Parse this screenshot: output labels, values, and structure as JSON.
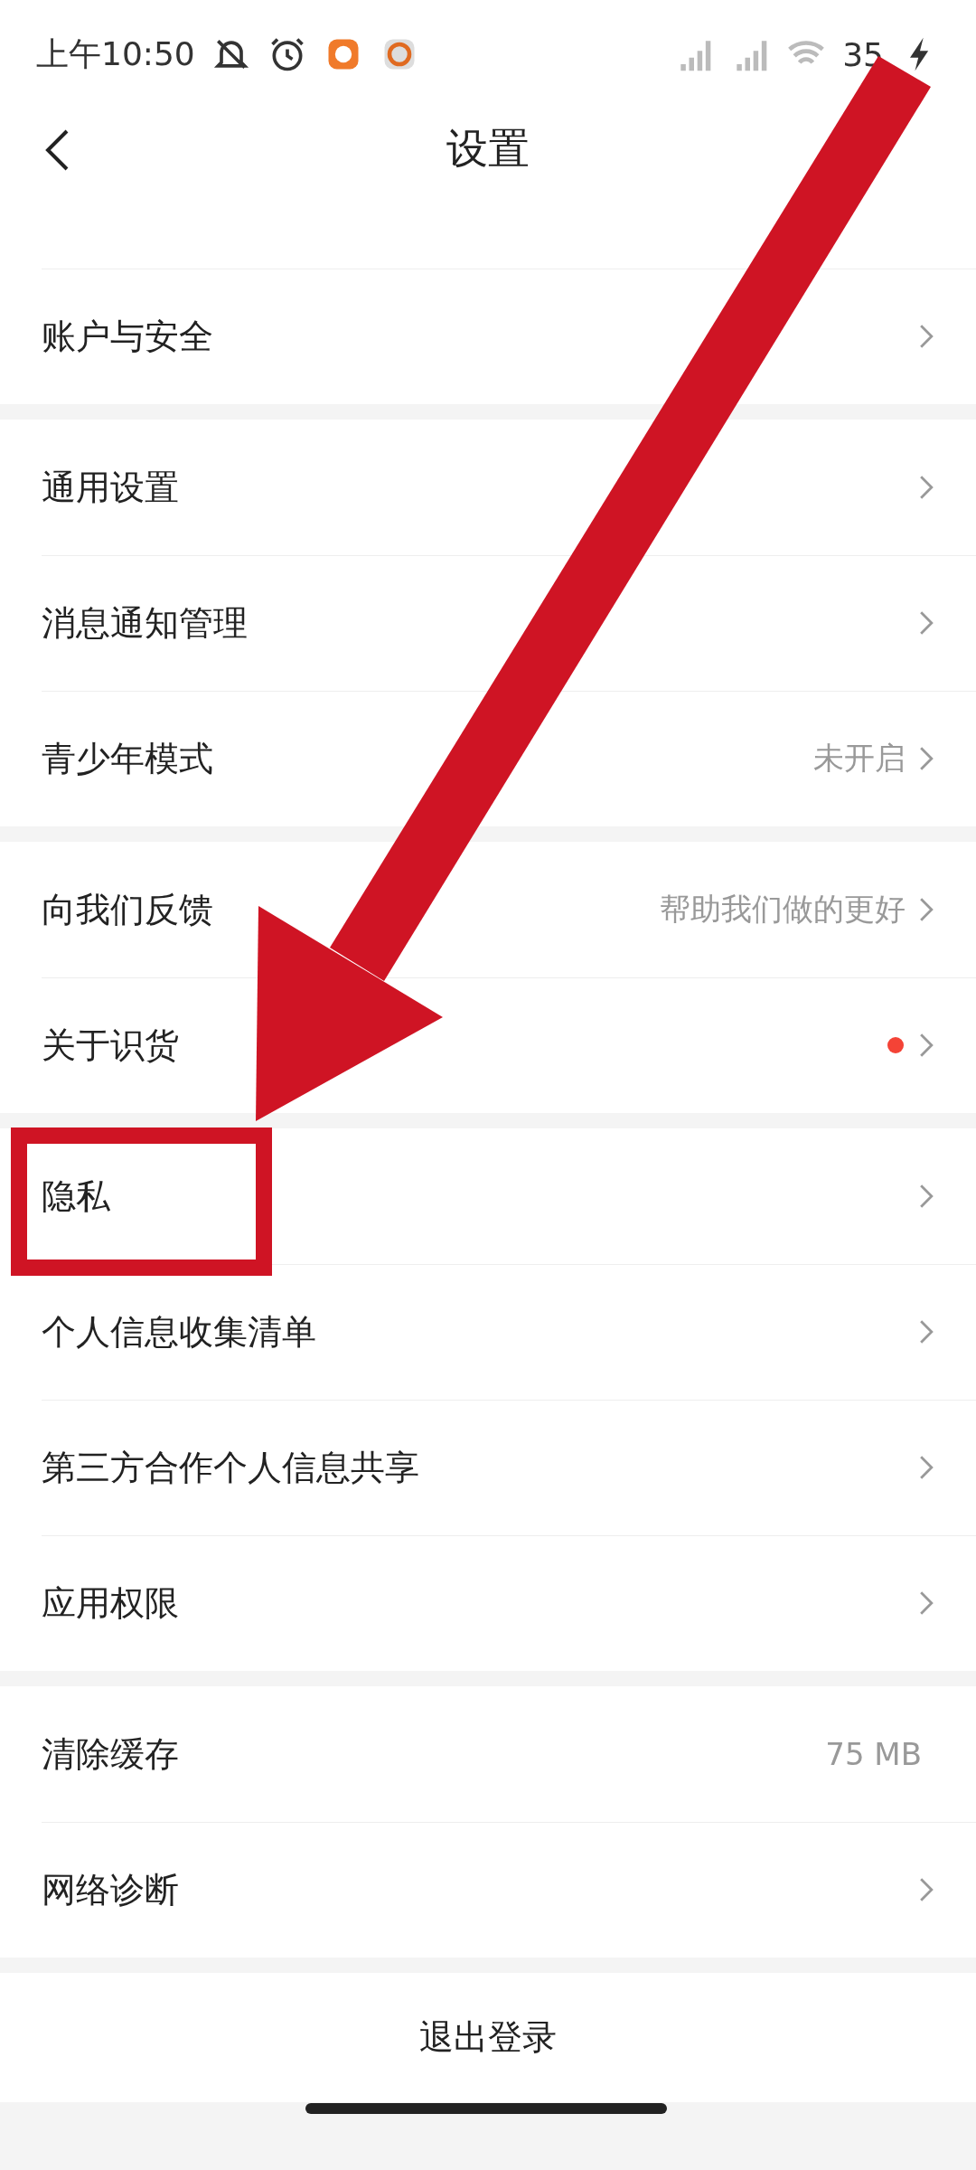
{
  "status_bar": {
    "time": "上午10:50",
    "battery": "35"
  },
  "header": {
    "title": "设置"
  },
  "groups": [
    {
      "rows": [
        {
          "kind": "cut"
        },
        {
          "kind": "link",
          "label": "账户与安全"
        }
      ]
    },
    {
      "rows": [
        {
          "kind": "link",
          "label": "通用设置"
        },
        {
          "kind": "link",
          "label": "消息通知管理"
        },
        {
          "kind": "link",
          "label": "青少年模式",
          "value": "未开启"
        }
      ]
    },
    {
      "rows": [
        {
          "kind": "link",
          "label": "向我们反馈",
          "value": "帮助我们做的更好"
        },
        {
          "kind": "link",
          "label": "关于识货",
          "dot": true
        }
      ]
    },
    {
      "rows": [
        {
          "kind": "link",
          "label": "隐私",
          "highlighted": true
        },
        {
          "kind": "link",
          "label": "个人信息收集清单"
        },
        {
          "kind": "link",
          "label": "第三方合作个人信息共享"
        },
        {
          "kind": "link",
          "label": "应用权限"
        }
      ]
    },
    {
      "rows": [
        {
          "kind": "info",
          "label": "清除缓存",
          "value": "75 MB"
        },
        {
          "kind": "link",
          "label": "网络诊断"
        }
      ]
    }
  ],
  "logout": "退出登录"
}
